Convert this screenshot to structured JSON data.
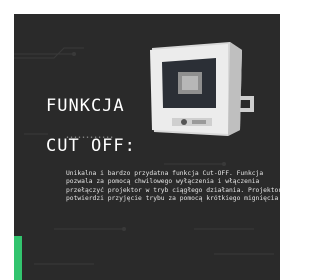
{
  "heading": {
    "line1": "FUNKCJA",
    "line2": "CUT OFF:"
  },
  "separator_dots": "••••••••••••",
  "description": "Unikalna i bardzo przydatna funkcja Cut-OFF. Funkcja pozwala za pomocą chwilowego wyłączenia i włączenia przełączyć projektor w tryb ciągłego działania. Projektor potwierdzi przyjęcie trybu za pomocą krótkiego mignięcia",
  "colors": {
    "panel": "#2a2a2a",
    "accent": "#32c46e",
    "text": "#ffffff"
  },
  "image": {
    "icon": "led-floodlight-with-sensor"
  }
}
